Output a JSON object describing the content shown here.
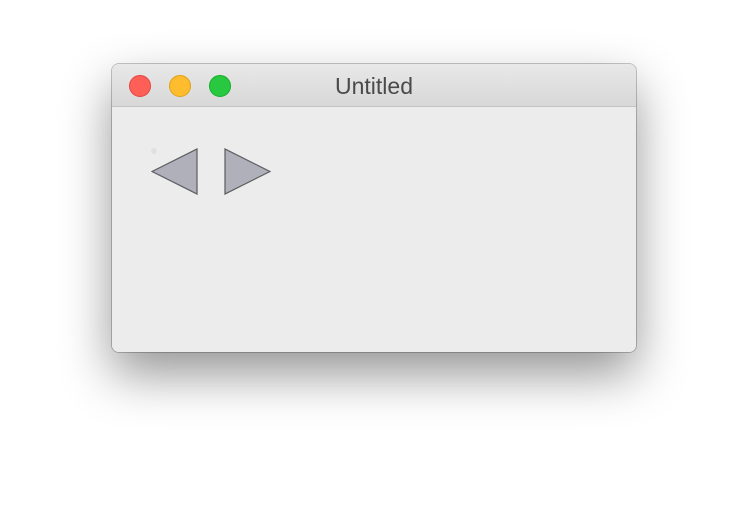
{
  "window": {
    "title": "Untitled",
    "traffic_lights": [
      {
        "name": "close",
        "color": "#fe5f57",
        "border": "#e2463f"
      },
      {
        "name": "minimize",
        "color": "#febc2e",
        "border": "#e1a116"
      },
      {
        "name": "zoom",
        "color": "#28c840",
        "border": "#14ae2a"
      }
    ]
  },
  "toolbar": {
    "back_icon": "triangle-left-icon",
    "forward_icon": "triangle-right-icon",
    "arrow_fill": "#b0b0ba",
    "arrow_stroke": "#5a5a5e"
  }
}
